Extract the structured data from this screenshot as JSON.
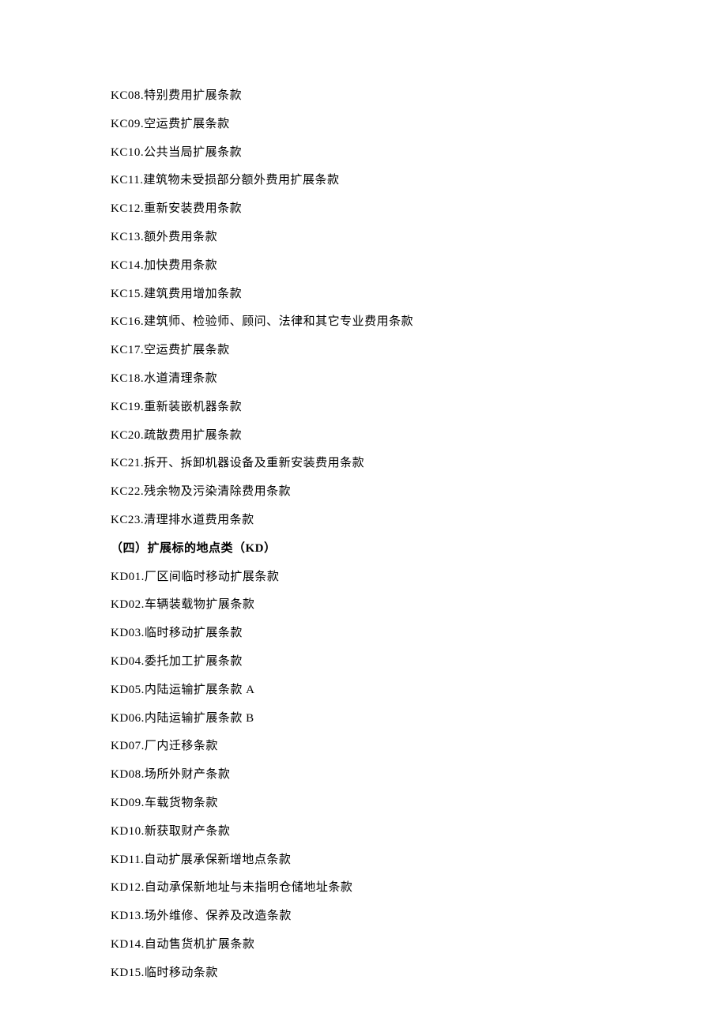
{
  "kc_items": [
    "KC08.特别费用扩展条款",
    "KC09.空运费扩展条款",
    "KC10.公共当局扩展条款",
    "KC11.建筑物未受损部分额外费用扩展条款",
    "KC12.重新安装费用条款",
    "KC13.额外费用条款",
    "KC14.加快费用条款",
    "KC15.建筑费用增加条款",
    "KC16.建筑师、检验师、顾问、法律和其它专业费用条款",
    "KC17.空运费扩展条款",
    "KC18.水道清理条款",
    "KC19.重新装嵌机器条款",
    "KC20.疏散费用扩展条款",
    "KC21.拆开、拆卸机器设备及重新安装费用条款",
    "KC22.残余物及污染清除费用条款",
    "KC23.清理排水道费用条款"
  ],
  "section_header": "（四）扩展标的地点类（KD）",
  "kd_items": [
    "KD01.厂区间临时移动扩展条款",
    "KD02.车辆装载物扩展条款",
    "KD03.临时移动扩展条款",
    "KD04.委托加工扩展条款",
    "KD05.内陆运输扩展条款 A",
    "KD06.内陆运输扩展条款 B",
    "KD07.厂内迁移条款",
    "KD08.场所外财产条款",
    "KD09.车载货物条款",
    "KD10.新获取财产条款",
    "KD11.自动扩展承保新增地点条款",
    "KD12.自动承保新地址与未指明仓储地址条款",
    "KD13.场外维修、保养及改造条款",
    "KD14.自动售货机扩展条款",
    "KD15.临时移动条款"
  ]
}
